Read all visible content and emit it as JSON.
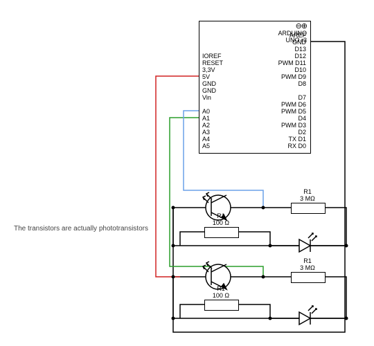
{
  "note": "The transistors are actually phototransistors",
  "arduino": {
    "logo_line1": "ARDUINO",
    "logo_line2": "UNO r3",
    "left_pins": [
      "IOREF",
      "RESET",
      "3,3V",
      "5V",
      "GND",
      "GND",
      "Vin",
      "",
      "A0",
      "A1",
      "A2",
      "A3",
      "A4",
      "A5"
    ],
    "right_pins": [
      "AREF",
      "GND",
      "D13",
      "D12",
      "PWM  D11",
      "D10",
      "PWM  D9",
      "D8",
      "",
      "D7",
      "PWM  D6",
      "PWM  D5",
      "D4",
      "PWM  D3",
      "D2",
      "TX  D1",
      "RX  D0"
    ]
  },
  "components": {
    "r_top_right_name": "R1",
    "r_top_right_val": "3 MΩ",
    "r_top_left_name": "R1",
    "r_top_left_val": "100 Ω",
    "r_bot_right_name": "R1",
    "r_bot_right_val": "3 MΩ",
    "r_bot_left_name": "R1",
    "r_bot_left_val": "100 Ω"
  },
  "chart_data": {
    "type": "schematic",
    "mcu": "Arduino UNO r3",
    "note": "The transistors are actually phototransistors",
    "channels": [
      {
        "analog_pin": "A0",
        "phototransistor": {
          "bias_resistor": "3 MΩ",
          "bias_to": "GND"
        },
        "led": {
          "series_resistor": "100 Ω"
        }
      },
      {
        "analog_pin": "A1",
        "phototransistor": {
          "bias_resistor": "3 MΩ",
          "bias_to": "GND"
        },
        "led": {
          "series_resistor": "100 Ω"
        }
      }
    ],
    "power": {
      "supply": "5V",
      "ground": "GND"
    }
  }
}
